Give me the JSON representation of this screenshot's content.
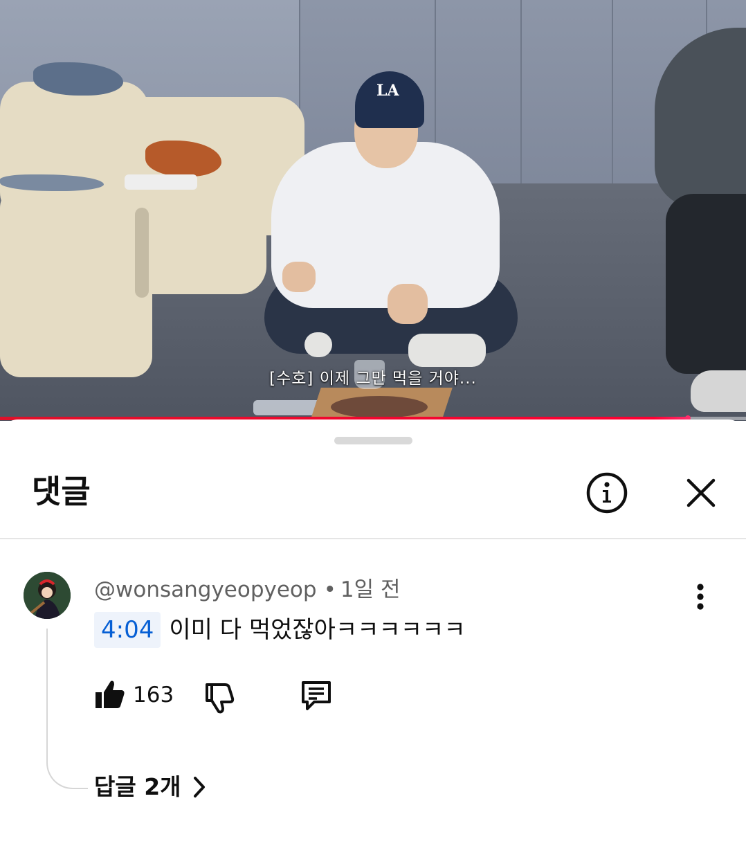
{
  "video": {
    "subtitle": "[수호] 이제 그만 먹을 거야...",
    "cap_logo": "LA",
    "progress_fraction": 0.922,
    "progress_color": "#ff0033"
  },
  "sheet": {
    "title": "댓글",
    "info_icon": "info-icon",
    "close_icon": "close-icon"
  },
  "comment": {
    "author": "@wonsangyeopyeop",
    "separator": "•",
    "age": "1일 전",
    "timestamp": "4:04",
    "text": "이미 다 먹었잖아ㅋㅋㅋㅋㅋㅋ",
    "like_count": "163",
    "like_icon": "thumbs-up-icon",
    "dislike_icon": "thumbs-down-icon",
    "reply_icon": "reply-icon",
    "more_icon": "more-vert-icon",
    "replies_label": "답글 2개",
    "timestamp_color": "#065fd4"
  }
}
